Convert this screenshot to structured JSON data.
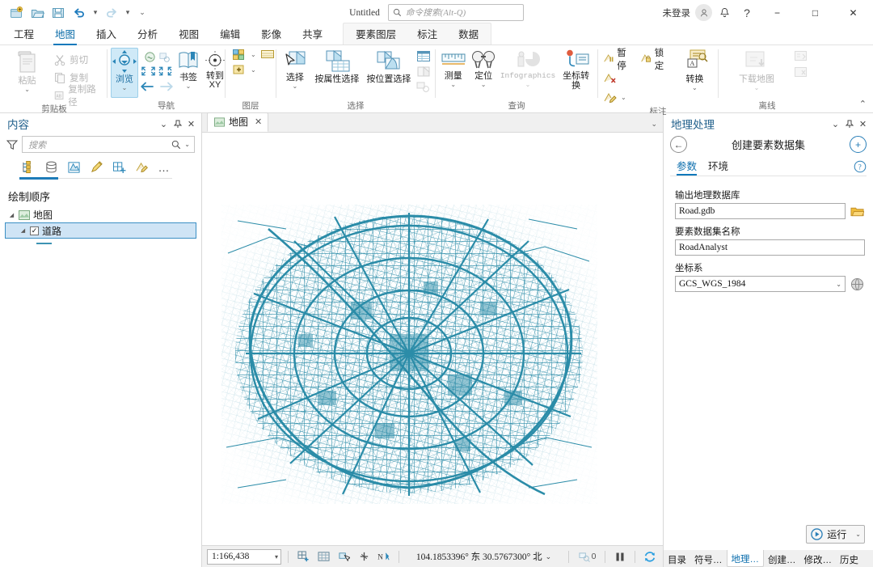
{
  "titlebar": {
    "doc_title": "Untitled",
    "search_placeholder": "命令搜索(Alt-Q)",
    "sign_in": "未登录",
    "quick_access": [
      "new-project-icon",
      "open-project-icon",
      "save-project-icon",
      "undo-icon",
      "redo-icon",
      "customize-qat-icon"
    ],
    "window_controls": {
      "minimize": "−",
      "maximize": "□",
      "close": "✕"
    },
    "help_glyph": "?",
    "notification_icon": "bell-icon"
  },
  "ribbon": {
    "tabs": [
      {
        "label": "工程",
        "active": false
      },
      {
        "label": "地图",
        "active": true
      },
      {
        "label": "插入",
        "active": false
      },
      {
        "label": "分析",
        "active": false
      },
      {
        "label": "视图",
        "active": false
      },
      {
        "label": "编辑",
        "active": false
      },
      {
        "label": "影像",
        "active": false
      },
      {
        "label": "共享",
        "active": false
      }
    ],
    "contextual_tabs": [
      {
        "label": "要素图层"
      },
      {
        "label": "标注"
      },
      {
        "label": "数据"
      }
    ],
    "groups": [
      {
        "name": "剪贴板",
        "big": [
          {
            "label": "粘贴",
            "caret": "⌄",
            "disabled": true
          }
        ],
        "small": [
          {
            "label": "剪切",
            "disabled": true
          },
          {
            "label": "复制",
            "disabled": true
          },
          {
            "label": "复制路径",
            "disabled": true
          }
        ]
      },
      {
        "name": "导航",
        "big": [
          {
            "label": "浏览",
            "caret": "⌄",
            "selected": true
          },
          {
            "label": "书签",
            "caret": "⌄"
          },
          {
            "label": "转到XY"
          }
        ]
      },
      {
        "name": "图层",
        "big": []
      },
      {
        "name": "选择",
        "big": [
          {
            "label": "选择",
            "caret": "⌄"
          },
          {
            "label": "按属性选择"
          },
          {
            "label": "按位置选择"
          }
        ]
      },
      {
        "name": "查询",
        "big": [
          {
            "label": "测量",
            "caret": "⌄"
          },
          {
            "label": "定位",
            "caret": "⌄"
          },
          {
            "label": "Infographics",
            "caret": "⌄",
            "disabled": true
          },
          {
            "label": "坐标转换"
          }
        ]
      },
      {
        "name": "标注",
        "small": [
          {
            "label": "暂停"
          },
          {
            "label": "锁定"
          }
        ],
        "big": [
          {
            "label": "转换",
            "caret": "⌄"
          }
        ]
      },
      {
        "name": "离线",
        "big": [
          {
            "label": "下载地图",
            "caret": "⌄",
            "disabled": true
          }
        ]
      }
    ],
    "collapse_glyph": "⌃"
  },
  "contents_panel": {
    "title": "内容",
    "search_placeholder": "搜索",
    "header_buttons": [
      "chevron-down-icon",
      "pin-icon",
      "close-icon"
    ],
    "toolbar_icons": [
      "list-by-drawing-order-icon",
      "list-by-data-source-icon",
      "list-by-selection-icon",
      "list-by-editing-icon",
      "list-by-snapping-icon",
      "list-by-labeling-icon",
      "more-options-icon"
    ],
    "section_label": "绘制顺序",
    "tree": [
      {
        "label": "地图",
        "level": 1,
        "selected": false,
        "checkbox": false
      },
      {
        "label": "道路",
        "level": 2,
        "selected": true,
        "checkbox": true,
        "checked": true
      }
    ]
  },
  "map_view": {
    "tab_label": "地图",
    "tab_close": "✕",
    "layer_color": "#2b8ca8",
    "background": "#ffffff"
  },
  "status_bar": {
    "scale": "1:166,438",
    "coordinates": "104.1853396° 东  30.5767300° 北",
    "selection_count": "0",
    "tool_icons": [
      "add-data-icon",
      "basemap-icon",
      "select-icon",
      "clear-selection-icon",
      "north-icon"
    ],
    "pause_icon": "pause-icon",
    "refresh_icon": "refresh-icon"
  },
  "geoprocessing_panel": {
    "title": "地理处理",
    "tool_title": "创建要素数据集",
    "back_glyph": "←",
    "add_glyph": "+",
    "header_buttons": [
      "chevron-down-icon",
      "pin-icon",
      "close-icon"
    ],
    "tabs": [
      {
        "label": "参数",
        "active": true
      },
      {
        "label": "环境",
        "active": false
      }
    ],
    "help_glyph": "?",
    "fields": [
      {
        "label": "输出地理数据库",
        "value": "Road.gdb",
        "side_icon": "folder-icon",
        "type": "text"
      },
      {
        "label": "要素数据集名称",
        "value": "RoadAnalyst",
        "type": "text"
      },
      {
        "label": "坐标系",
        "value": "GCS_WGS_1984",
        "side_icon": "globe-icon",
        "type": "select"
      }
    ],
    "run_label": "运行",
    "run_caret": "⌄"
  },
  "dock_tabs": [
    {
      "label": "目录",
      "active": false
    },
    {
      "label": "符号…",
      "active": false
    },
    {
      "label": "地理…",
      "active": true
    },
    {
      "label": "创建…",
      "active": false
    },
    {
      "label": "修改…",
      "active": false
    },
    {
      "label": "历史",
      "active": false
    }
  ]
}
